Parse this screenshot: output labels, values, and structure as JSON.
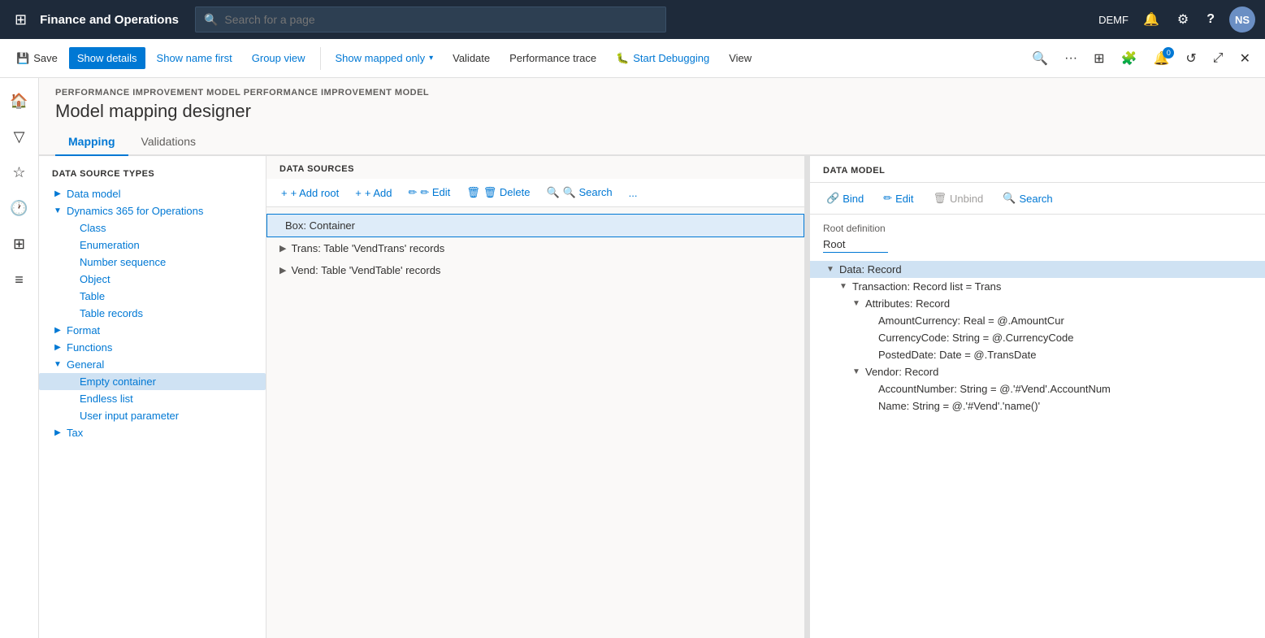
{
  "topbar": {
    "grid_icon": "⊞",
    "title": "Finance and Operations",
    "search_placeholder": "Search for a page",
    "user": "DEMF",
    "avatar": "NS",
    "icons": {
      "bell": "🔔",
      "gear": "⚙",
      "help": "?"
    }
  },
  "commandbar": {
    "save_label": "Save",
    "show_details_label": "Show details",
    "show_name_first_label": "Show name first",
    "group_view_label": "Group view",
    "show_mapped_only_label": "Show mapped only",
    "validate_label": "Validate",
    "performance_trace_label": "Performance trace",
    "start_debugging_label": "Start Debugging",
    "view_label": "View"
  },
  "breadcrumb": "PERFORMANCE IMPROVEMENT MODEL  PERFORMANCE IMPROVEMENT MODEL",
  "page_title": "Model mapping designer",
  "tabs": [
    "Mapping",
    "Validations"
  ],
  "active_tab": "Mapping",
  "left_panel": {
    "header": "DATA SOURCE TYPES",
    "items": [
      {
        "label": "Data model",
        "level": 1,
        "toggle": "▶",
        "expanded": false
      },
      {
        "label": "Dynamics 365 for Operations",
        "level": 1,
        "toggle": "▼",
        "expanded": true
      },
      {
        "label": "Class",
        "level": 2,
        "toggle": "",
        "expanded": false
      },
      {
        "label": "Enumeration",
        "level": 2,
        "toggle": "",
        "expanded": false
      },
      {
        "label": "Number sequence",
        "level": 2,
        "toggle": "",
        "expanded": false
      },
      {
        "label": "Object",
        "level": 2,
        "toggle": "",
        "expanded": false
      },
      {
        "label": "Table",
        "level": 2,
        "toggle": "",
        "expanded": false
      },
      {
        "label": "Table records",
        "level": 2,
        "toggle": "",
        "expanded": false
      },
      {
        "label": "Format",
        "level": 1,
        "toggle": "▶",
        "expanded": false
      },
      {
        "label": "Functions",
        "level": 1,
        "toggle": "▶",
        "expanded": false
      },
      {
        "label": "General",
        "level": 1,
        "toggle": "▼",
        "expanded": true
      },
      {
        "label": "Empty container",
        "level": 2,
        "toggle": "",
        "expanded": false,
        "selected": true
      },
      {
        "label": "Endless list",
        "level": 2,
        "toggle": "",
        "expanded": false
      },
      {
        "label": "User input parameter",
        "level": 2,
        "toggle": "",
        "expanded": false
      },
      {
        "label": "Tax",
        "level": 1,
        "toggle": "▶",
        "expanded": false
      }
    ]
  },
  "middle_panel": {
    "header": "DATA SOURCES",
    "toolbar": {
      "add_root_label": "+ Add root",
      "add_label": "+ Add",
      "edit_label": "✏ Edit",
      "delete_label": "🗑 Delete",
      "search_label": "🔍 Search",
      "more_label": "..."
    },
    "items": [
      {
        "label": "Box: Container",
        "toggle": "",
        "selected": true
      },
      {
        "label": "Trans: Table 'VendTrans' records",
        "toggle": "▶",
        "selected": false
      },
      {
        "label": "Vend: Table 'VendTable' records",
        "toggle": "▶",
        "selected": false
      }
    ]
  },
  "right_panel": {
    "header": "DATA MODEL",
    "toolbar": {
      "bind_label": "Bind",
      "edit_label": "Edit",
      "unbind_label": "Unbind",
      "search_label": "Search"
    },
    "root_definition_label": "Root definition",
    "root_definition_value": "Root",
    "tree": [
      {
        "label": "Data: Record",
        "level": 1,
        "toggle": "▼",
        "selected": true
      },
      {
        "label": "Transaction: Record list = Trans",
        "level": 2,
        "toggle": "▼",
        "selected": false
      },
      {
        "label": "Attributes: Record",
        "level": 3,
        "toggle": "▼",
        "selected": false
      },
      {
        "label": "AmountCurrency: Real = @.AmountCur",
        "level": 4,
        "toggle": "",
        "selected": false
      },
      {
        "label": "CurrencyCode: String = @.CurrencyCode",
        "level": 4,
        "toggle": "",
        "selected": false
      },
      {
        "label": "PostedDate: Date = @.TransDate",
        "level": 4,
        "toggle": "",
        "selected": false
      },
      {
        "label": "Vendor: Record",
        "level": 3,
        "toggle": "▼",
        "selected": false
      },
      {
        "label": "AccountNumber: String = @.'#Vend'.AccountNum",
        "level": 4,
        "toggle": "",
        "selected": false
      },
      {
        "label": "Name: String = @.'#Vend'.'name()'",
        "level": 4,
        "toggle": "",
        "selected": false
      }
    ]
  }
}
